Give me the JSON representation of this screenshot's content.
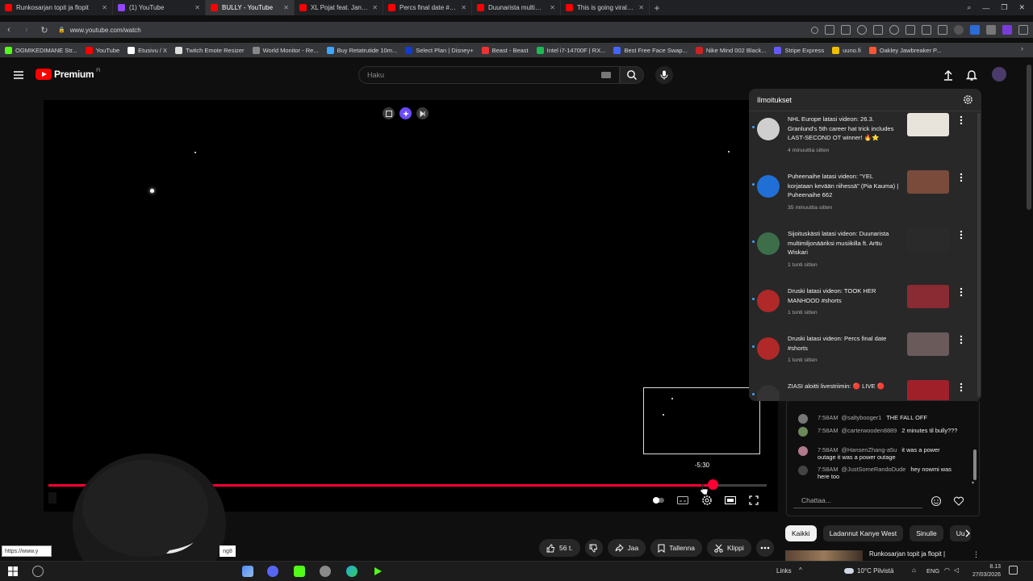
{
  "browser": {
    "tabs": [
      {
        "label": "Runkosarjan topit ja flopit",
        "color": "#ff0000",
        "active": false
      },
      {
        "label": "(1) YouTube",
        "color": "#9146ff",
        "active": false
      },
      {
        "label": "BULLY - YouTube",
        "color": "#ff0000",
        "active": true
      },
      {
        "label": "XL Pojat feat. Janne Ranta",
        "color": "#ff0000",
        "active": false
      },
      {
        "label": "Percs final date #shorts - Y",
        "color": "#ff0000",
        "active": false
      },
      {
        "label": "Duunarista multimiljonääri",
        "color": "#ff0000",
        "active": false
      },
      {
        "label": "This is going viral right no",
        "color": "#ff0000",
        "active": false
      }
    ],
    "url": "www.youtube.com/watch",
    "bookmarks": [
      {
        "label": "OGMIKEDIMANE Str...",
        "color": "#53fc18"
      },
      {
        "label": "YouTube",
        "color": "#ff0000"
      },
      {
        "label": "Etusivu / X",
        "color": "#ffffff"
      },
      {
        "label": "Twitch Emote Resizer",
        "color": "#dddddd"
      },
      {
        "label": "World Monitor - Re...",
        "color": "#888888"
      },
      {
        "label": "Buy Retatrutide 10m...",
        "color": "#3ea6ff"
      },
      {
        "label": "Select Plan | Disney+",
        "color": "#113ccf"
      },
      {
        "label": "Beast - Beast",
        "color": "#e33"
      },
      {
        "label": "Intel i7-14700F | RX...",
        "color": "#1db954"
      },
      {
        "label": "Best Free Face Swap...",
        "color": "#4466ff"
      },
      {
        "label": "Nike Mind 002 Black...",
        "color": "#cc2222"
      },
      {
        "label": "Stripe Express",
        "color": "#635bff"
      },
      {
        "label": "uuno.fi",
        "color": "#f0c000"
      },
      {
        "label": "Oakley Jawbreaker P...",
        "color": "#ff5533"
      }
    ]
  },
  "youtube": {
    "logo_word": "Premium",
    "logo_region": "FI",
    "search_placeholder": "Haku"
  },
  "player": {
    "progress_fraction": 0.925,
    "preview_time": "-5:30"
  },
  "actions": {
    "likes": "56 t.",
    "share": "Jaa",
    "save": "Tallenna",
    "clip": "Klippi"
  },
  "status_bar": {
    "url": "https://www.y",
    "fragment": "ng8"
  },
  "notifications": {
    "title": "Ilmoitukset",
    "items": [
      {
        "text": "NHL Europe latasi videon: 26.3. Granlund's 5th career hat trick includes LAST-SECOND OT winner! 🔥⭐",
        "time": "4 minuuttia sitten",
        "avatar_color": "#cfcfcf",
        "thumb_color": "#e8e4dc"
      },
      {
        "text": "Puheenaihe latasi videon: \"YEL korjataan kevään riihessä\" (Pia Kauma) | Puheenaihe 662",
        "time": "35 minuuttia sitten",
        "avatar_color": "#1f6fd6",
        "thumb_color": "#7a4a3a"
      },
      {
        "text": "Sijoituskästi latasi videon: Duunarista multimiljonääriksi musiikilla ft. Arttu Wiskari",
        "time": "1 tunti sitten",
        "avatar_color": "#3c6e4a",
        "thumb_color": "#2a2a2a"
      },
      {
        "text": "Druski latasi videon: TOOK HER MANHOOD #shorts",
        "time": "1 tunti sitten",
        "avatar_color": "#b02828",
        "thumb_color": "#8a2a33"
      },
      {
        "text": "Druski latasi videon: Percs final date #shorts",
        "time": "1 tunti sitten",
        "avatar_color": "#b02828",
        "thumb_color": "#6a5a5a"
      },
      {
        "text": "ZIASI aloitti livestriimin: 🔴 LIVE 🔴",
        "time": "",
        "avatar_color": "#333333",
        "thumb_color": "#a0202a"
      }
    ]
  },
  "chat": {
    "messages": [
      {
        "time": "7:58AM",
        "user": "@saltybooger1",
        "text": "THE FALL OFF",
        "avatar_color": "#777777"
      },
      {
        "time": "7:58AM",
        "user": "@carterwooden8889",
        "text": "2 minutes til bully???",
        "avatar_color": "#6a8a5a"
      },
      {
        "time": "7:58AM",
        "user": "@HansenZhang-a5u",
        "text": "it was a power outage it was a power outage",
        "avatar_color": "#b07a8a"
      },
      {
        "time": "7:58AM",
        "user": "@JustSomeRandoDude",
        "text": "hey nowmi was here too",
        "avatar_color": "#444444"
      }
    ],
    "input_placeholder": "Chattaa..."
  },
  "chips": [
    "Kaikki",
    "Ladannut Kanye West",
    "Sinulle",
    "Uu"
  ],
  "recommendation": {
    "title": "Runkosarjan topit ja flopit |"
  },
  "taskbar": {
    "links_label": "Links",
    "weather": "10°C  Pilvistä",
    "lang": "ENG",
    "time": "8.13",
    "date": "27/03/2026"
  }
}
